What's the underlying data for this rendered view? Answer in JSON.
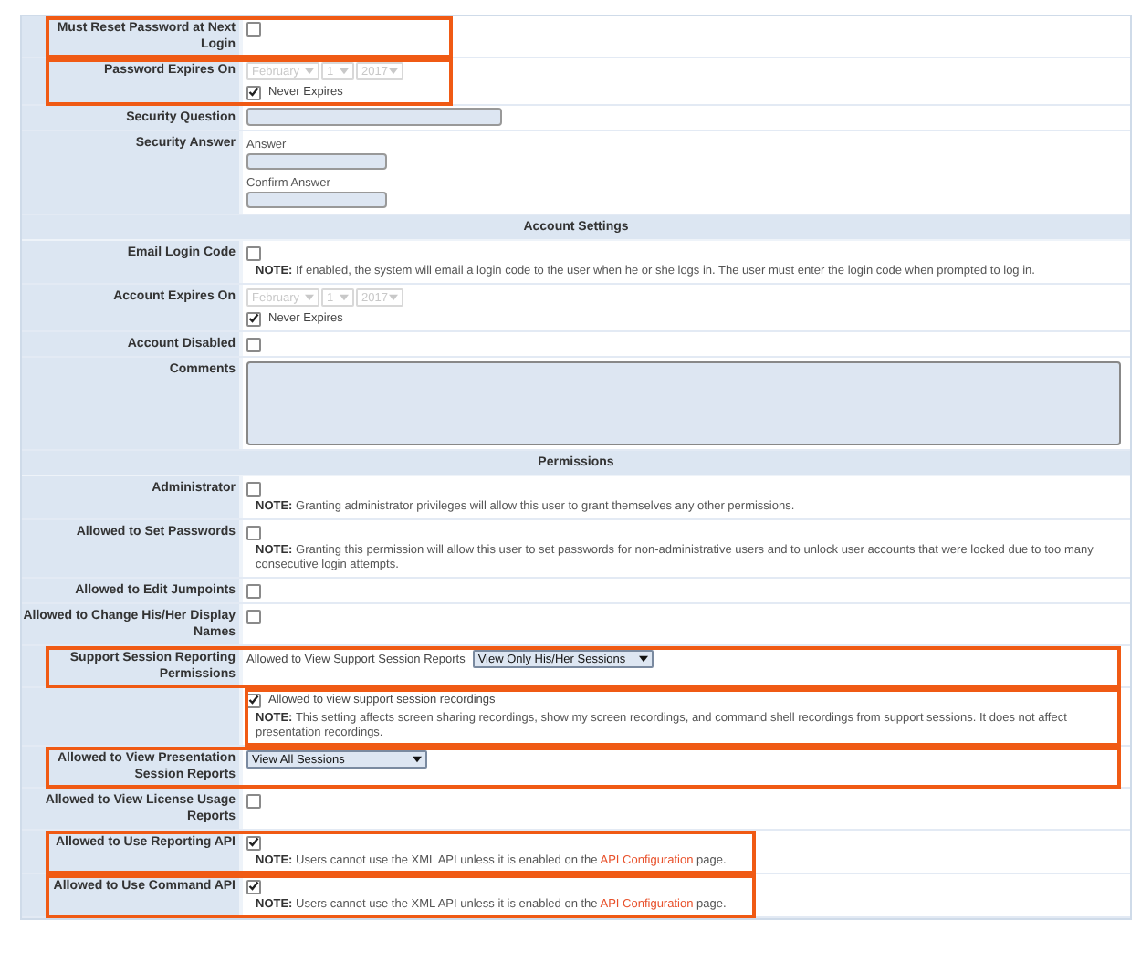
{
  "rows": [
    {
      "kind": "checkbox",
      "label": "Must Reset Password at Next Login",
      "checked": false,
      "highlight": {
        "kind": "short"
      }
    },
    {
      "kind": "date",
      "label": "Password Expires On",
      "month": "February",
      "day": "1",
      "year": "2017",
      "never_label": "Never Expires",
      "checked": true,
      "highlight": {
        "kind": "short"
      }
    },
    {
      "kind": "text",
      "label": "Security Question"
    },
    {
      "kind": "answer",
      "label": "Security Answer",
      "fields": [
        "Answer",
        "Confirm Answer"
      ]
    },
    {
      "kind": "header",
      "label": "Account Settings"
    },
    {
      "kind": "checkbox",
      "label": "Email Login Code",
      "checked": false,
      "note_label": "NOTE:",
      "note": "If enabled, the system will email a login code to the user when he or she logs in. The user must enter the login code when prompted to log in."
    },
    {
      "kind": "date",
      "label": "Account Expires On",
      "month": "February",
      "day": "1",
      "year": "2017",
      "never_label": "Never Expires",
      "checked": true
    },
    {
      "kind": "checkbox",
      "label": "Account Disabled",
      "checked": false
    },
    {
      "kind": "textarea",
      "label": "Comments"
    },
    {
      "kind": "header",
      "label": "Permissions"
    },
    {
      "kind": "checkbox",
      "label": "Administrator",
      "checked": false,
      "note_label": "NOTE:",
      "note": "Granting administrator privileges will allow this user to grant themselves any other permissions."
    },
    {
      "kind": "checkbox",
      "label": "Allowed to Set Passwords",
      "checked": false,
      "note_label": "NOTE:",
      "note": "Granting this permission will allow this user to set passwords for non-administrative users and to unlock user accounts that were locked due to too many consecutive login attempts."
    },
    {
      "kind": "checkbox",
      "label": "Allowed to Edit Jumpoints",
      "checked": false
    },
    {
      "kind": "checkbox",
      "label": "Allowed to Change His/Her Display Names",
      "checked": false
    },
    {
      "kind": "select",
      "label": "Support Session Reporting Permissions",
      "prefix": "Allowed to View Support Session Reports",
      "value": "View Only His/Her Sessions",
      "highlight": {
        "kind": "full"
      }
    },
    {
      "kind": "checkbox",
      "checked": true,
      "inline": "Allowed to view support session recordings",
      "note_label": "NOTE:",
      "note": "This setting affects screen sharing recordings, show my screen recordings, and command shell recordings from support sessions. It does not affect presentation recordings.",
      "highlight": {
        "kind": "value"
      }
    },
    {
      "kind": "select",
      "label": "Allowed to View Presentation Session Reports",
      "value": "View All Sessions",
      "highlight": {
        "kind": "full"
      }
    },
    {
      "kind": "checkbox",
      "label": "Allowed to View License Usage Reports",
      "checked": false
    },
    {
      "kind": "checkbox",
      "label": "Allowed to Use Reporting API",
      "checked": true,
      "note_label": "NOTE:",
      "note": "Users cannot use the XML API unless it is enabled on the",
      "link": "API Configuration",
      "note_end": "page.",
      "highlight": {
        "kind": "medium"
      }
    },
    {
      "kind": "checkbox",
      "label": "Allowed to Use Command API",
      "checked": true,
      "note_label": "NOTE:",
      "note": "Users cannot use the XML API unless it is enabled on the",
      "link": "API Configuration",
      "note_end": "page.",
      "highlight": {
        "kind": "medium"
      }
    }
  ]
}
